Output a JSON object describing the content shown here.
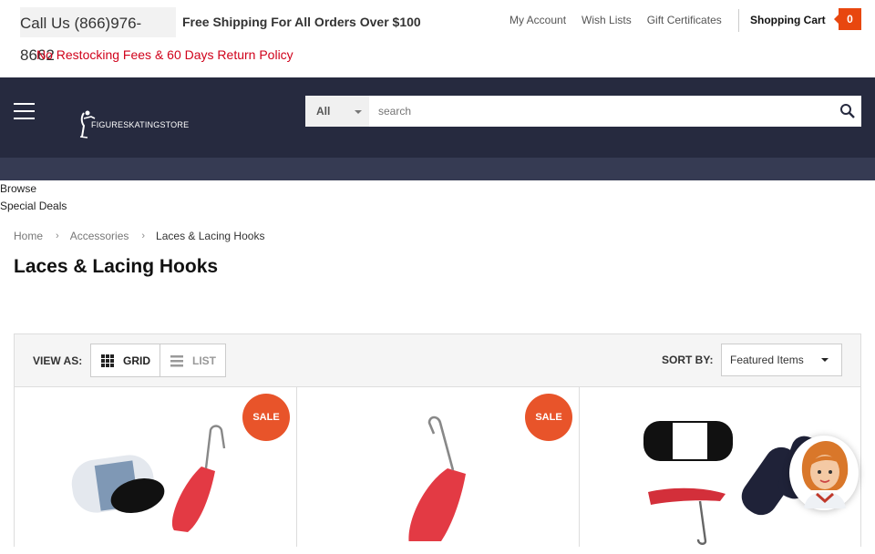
{
  "header": {
    "phone": "Call Us (866)976-8662",
    "shipping": "Free Shipping For All Orders Over $100",
    "policy": "No Restocking Fees & 60 Days Return Policy",
    "links": [
      "My Account",
      "Wish Lists",
      "Gift Certificates"
    ],
    "cart_label": "Shopping Cart",
    "cart_count": "0",
    "accent_color": "#e8470f",
    "policy_color": "#d0021b"
  },
  "nav": {
    "logo_text": "FIGURESKATINGSTORE",
    "search_category": "All",
    "search_placeholder": "search",
    "menu": [
      "Browse",
      "Special Deals"
    ],
    "bar_color": "#262a3f"
  },
  "breadcrumb": {
    "items": [
      "Home",
      "Accessories",
      "Laces & Lacing Hooks"
    ]
  },
  "page": {
    "title": "Laces & Lacing Hooks"
  },
  "toolbar": {
    "view_as": "VIEW AS:",
    "grid_label": "GRID",
    "list_label": "LIST",
    "sort_by": "SORT BY:",
    "sort_value": "Featured Items"
  },
  "products": [
    {
      "badge": "SALE",
      "image": "lacing-hook-with-guards"
    },
    {
      "badge": "SALE",
      "image": "red-lacing-hook"
    },
    {
      "badge": "",
      "image": "edea-laces-hook-guards-set"
    }
  ],
  "chat": {
    "icon": "support-agent-avatar"
  }
}
